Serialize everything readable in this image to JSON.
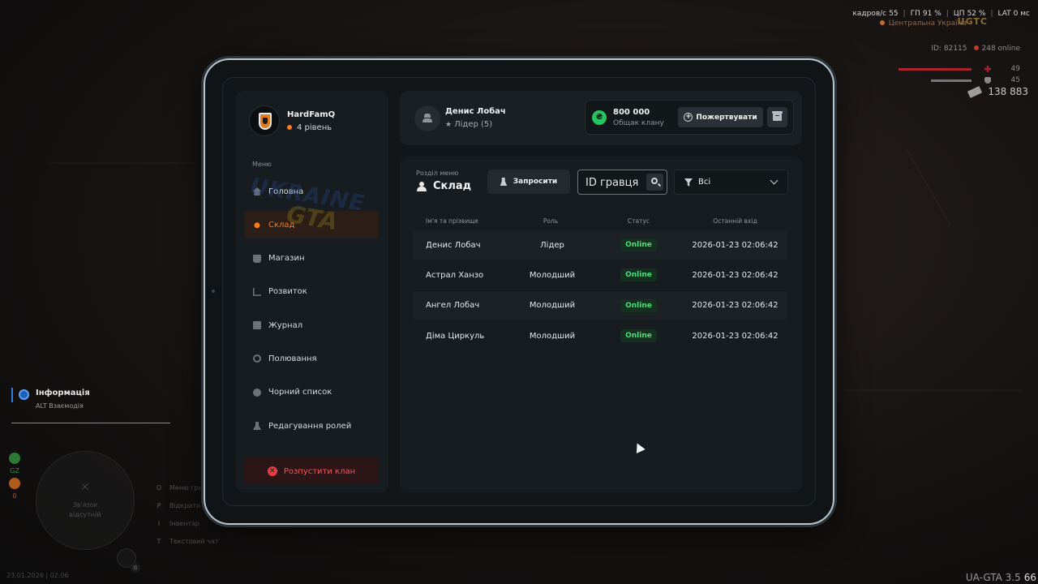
{
  "hud": {
    "stats": [
      {
        "label": "кадров/с",
        "value": "55"
      },
      {
        "label": "ГП",
        "value": "91 %"
      },
      {
        "label": "ЦП",
        "value": "52 %"
      },
      {
        "label": "LAT",
        "value": "0 мс"
      }
    ],
    "region": "Центральна Україна",
    "logo": "UGTC",
    "player_id": "ID: 82115",
    "online": "248 online",
    "health": "49",
    "armor": "45",
    "cash": "138 883"
  },
  "interaction_hint": {
    "title": "Інформація",
    "subtitle": "ALT Взаємодія"
  },
  "side_icons": [
    {
      "label": "GZ",
      "color": "#2a7a36"
    },
    {
      "label": "0",
      "color": "#b05a1a"
    }
  ],
  "minimap_text": [
    "Зв'язок",
    "відсутній"
  ],
  "key_hints": [
    {
      "key": "O",
      "label": "Меню гри"
    },
    {
      "key": "P",
      "label": "Відкрити"
    },
    {
      "key": "I",
      "label": "Інвентар"
    },
    {
      "key": "T",
      "label": "Текстовий чат"
    }
  ],
  "mic_badge": "B",
  "bottom_date": "23.01.2026 | 02:06",
  "version": "UA-GTA 3.5",
  "fps_corner": "66",
  "clan": {
    "name": "HardFamQ",
    "level": "4 рівень"
  },
  "menu": {
    "caption": "Меню",
    "items": [
      {
        "label": "Головна",
        "icon": "home-icon"
      },
      {
        "label": "Склад",
        "icon": "people-icon"
      },
      {
        "label": "Магазин",
        "icon": "shop-icon"
      },
      {
        "label": "Розвиток",
        "icon": "chart-icon"
      },
      {
        "label": "Журнал",
        "icon": "journal-icon"
      },
      {
        "label": "Полювання",
        "icon": "target-icon"
      },
      {
        "label": "Чорний список",
        "icon": "block-icon"
      },
      {
        "label": "Редагування ролей",
        "icon": "role-icon"
      }
    ],
    "active_item": "Склад",
    "disband": "Розпустити клан"
  },
  "user": {
    "name": "Денис Лобач",
    "role": "Лідер (5)"
  },
  "wallet": {
    "currency_symbol": "₴",
    "amount": "800 000",
    "note": "Общак клану",
    "donate": "Пожертвувати"
  },
  "section": {
    "caption": "Розділ меню",
    "title": "Склад",
    "invite": "Запросити",
    "search_value": "ID гравця",
    "filter_value": "Всі"
  },
  "table": {
    "headers": [
      "Ім'я та прізвище",
      "Роль",
      "Статус",
      "Останній вхід"
    ],
    "rows": [
      [
        "Денис Лобач",
        "Лідер",
        "Online",
        "2026-01-23 02:06:42"
      ],
      [
        "Астрал Ханзо",
        "Молодший",
        "Online",
        "2026-01-23 02:06:42"
      ],
      [
        "Ангел Лобач",
        "Молодший",
        "Online",
        "2026-01-23 02:06:42"
      ],
      [
        "Діма Циркуль",
        "Молодший",
        "Online",
        "2026-01-23 02:06:42"
      ]
    ]
  },
  "watermark": [
    "UKRAINE",
    "GTA"
  ],
  "colors": {
    "accent": "#ff7a1a",
    "online": "#4ade80",
    "danger": "#e23f45",
    "money": "#22c55e"
  }
}
